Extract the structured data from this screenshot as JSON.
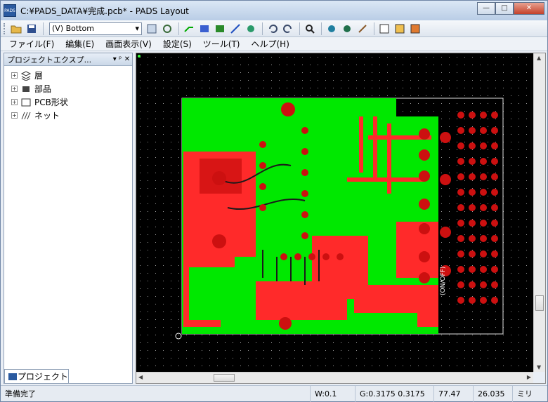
{
  "window": {
    "title": "C:¥PADS_DATA¥完成.pcb* - PADS Layout",
    "app_icon": "PADS",
    "minimize": "—",
    "maximize": "□",
    "close": "✕"
  },
  "toolbar": {
    "layer_value": "(V) Bottom",
    "icons": [
      "open-folder-icon",
      "save-icon",
      "layer-settings-icon",
      "redraw-icon",
      "route-icon",
      "autorouter-icon",
      "dimension-icon",
      "connect-icon",
      "spread-icon",
      "undo-icon",
      "redo-icon",
      "zoom-icon",
      "drc-icon",
      "verify-icon",
      "broom-icon",
      "cut-icon",
      "highlight-icon",
      "ecad-icon"
    ]
  },
  "menu": {
    "items": [
      "ファイル(F)",
      "編集(E)",
      "画面表示(V)",
      "設定(S)",
      "ツール(T)",
      "ヘルプ(H)"
    ]
  },
  "project_pane": {
    "title": "プロジェクトエクスプ...",
    "pin": "▾ ᵖ",
    "close": "✕",
    "tree": [
      {
        "label": "層",
        "icon": "layers-icon"
      },
      {
        "label": "部品",
        "icon": "component-icon"
      },
      {
        "label": "PCB形状",
        "icon": "pcb-shape-icon"
      },
      {
        "label": "ネット",
        "icon": "net-icon"
      }
    ],
    "tab_label": "プロジェクト"
  },
  "board": {
    "silk_text": "(ON/OFF)",
    "colors": {
      "background": "#000000",
      "copper_top": "#00ff00",
      "copper_bottom": "#ff2020",
      "pad": "#cc1010",
      "outline": "#ffffff",
      "trace": "#1a1a1a"
    }
  },
  "status": {
    "message": "準備完了",
    "width": "W:0.1",
    "grid": "G:0.3175 0.3175",
    "x": "77.47",
    "y": "26.035",
    "unit": "ミリ"
  }
}
